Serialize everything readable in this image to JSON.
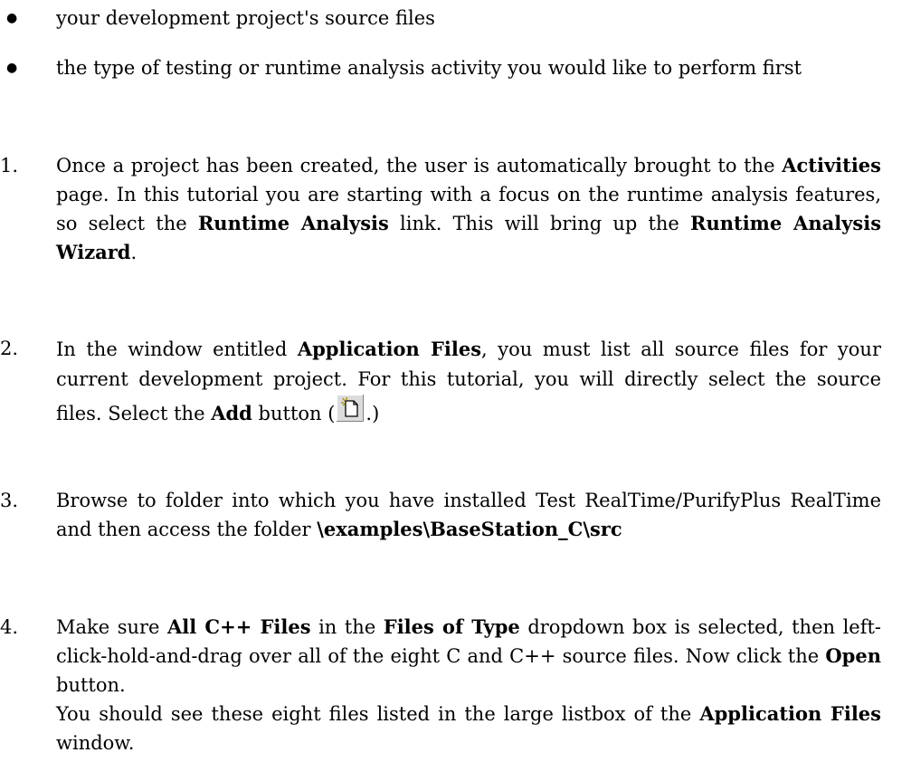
{
  "bullets": [
    "your development project's source files",
    "the type of testing or runtime analysis activity you would like to perform first"
  ],
  "steps": {
    "s1": {
      "num": "1.",
      "t1": "Once a project has been created, the user is automatically brought to the ",
      "b1": "Activities",
      "t2": " page. In this tutorial you are starting with a focus on the runtime analysis features, so select the ",
      "b2": "Runtime Analysis",
      "t3": " link. This will bring up the ",
      "b3": "Runtime Analysis Wizard",
      "t4": "."
    },
    "s2": {
      "num": "2.",
      "t1": "In the window entitled ",
      "b1": "Application Files",
      "t2": ", you must list all source files for your current development project. For this tutorial, you will directly select the source files. Select the ",
      "b2": "Add",
      "t3": " button (",
      "t4": ".)",
      "icon": "add-file-icon"
    },
    "s3": {
      "num": "3.",
      "t1": "Browse to folder into which you have installed Test RealTime/PurifyPlus RealTime and then access the folder ",
      "b1": "\\examples\\BaseStation_C\\src"
    },
    "s4": {
      "num": "4.",
      "t1": "Make sure ",
      "b1": "All C++ Files",
      "t2": " in the ",
      "b2": "Files of Type",
      "t3": " dropdown box is selected, then left-click-hold-and-drag over all of the eight C and C++ source files. Now click the ",
      "b3": "Open",
      "t4": " button.",
      "t5": "You should see these eight files listed in the large listbox of the ",
      "b4": "Application Files",
      "t6": " window."
    }
  }
}
